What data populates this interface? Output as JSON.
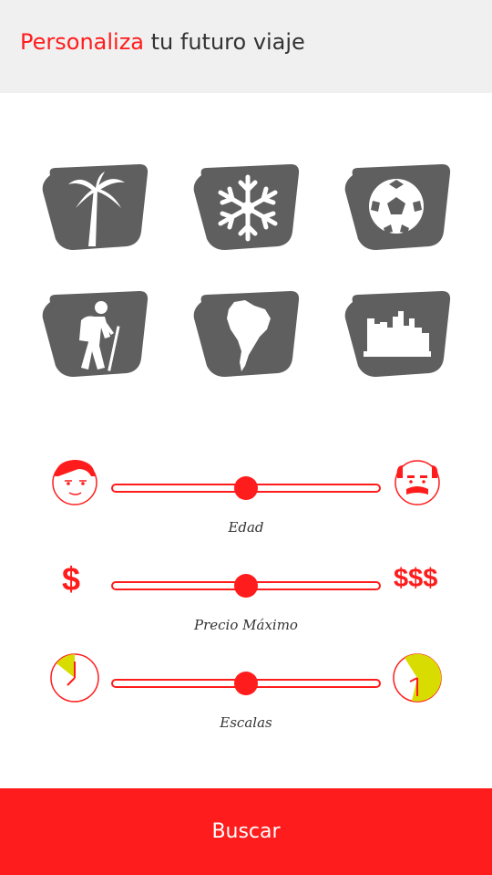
{
  "header": {
    "title_accent": "Personaliza",
    "title_rest": " tu futuro viaje"
  },
  "colors": {
    "accent": "#ff1c1c",
    "tile_bg": "#5f5f5f",
    "header_bg": "#f0f0f0",
    "clock_fill": "#d8dc00"
  },
  "categories": [
    {
      "icon": "palm-tree-icon"
    },
    {
      "icon": "snowflake-icon"
    },
    {
      "icon": "soccer-ball-icon"
    },
    {
      "icon": "hiker-icon"
    },
    {
      "icon": "south-america-icon"
    },
    {
      "icon": "city-skyline-icon"
    }
  ],
  "sliders": {
    "age": {
      "label": "Edad",
      "value": 0.5,
      "min_icon": "young-face-icon",
      "max_icon": "old-face-icon"
    },
    "price": {
      "label": "Precio Máximo",
      "value": 0.5,
      "min_text": "$",
      "max_text": "$$$"
    },
    "stops": {
      "label": "Escalas",
      "value": 0.5,
      "min_icon": "clock-few-icon",
      "max_icon": "clock-many-icon"
    }
  },
  "search_button": {
    "label": "Buscar"
  }
}
